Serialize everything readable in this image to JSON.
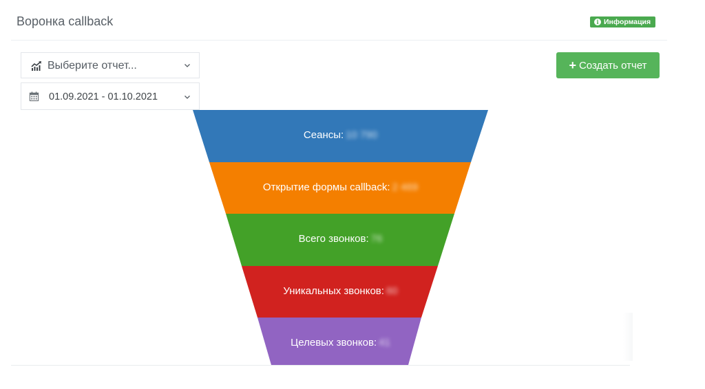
{
  "header": {
    "title": "Воронка callback",
    "info_badge": "Информация"
  },
  "filters": {
    "report_select": {
      "value": "Выберите отчет...",
      "icon": "chart-line-icon"
    },
    "date_select": {
      "value": "01.09.2021 - 01.10.2021",
      "icon": "calendar-icon"
    }
  },
  "actions": {
    "create_report": "Создать отчет"
  },
  "colors": {
    "badge": "#4aa94f",
    "button": "#56b45a"
  },
  "funnel": {
    "stages": [
      {
        "label": "Сеансы:",
        "value": "10 790",
        "color": "#3278b8"
      },
      {
        "label": "Открытие формы callback:",
        "value": "2 469",
        "color": "#f47f00"
      },
      {
        "label": "Всего звонков:",
        "value": "76",
        "color": "#43a128"
      },
      {
        "label": "Уникальных звонков:",
        "value": "60",
        "color": "#d1221f"
      },
      {
        "label": "Целевых звонков:",
        "value": "41",
        "color": "#9164c2"
      }
    ]
  }
}
